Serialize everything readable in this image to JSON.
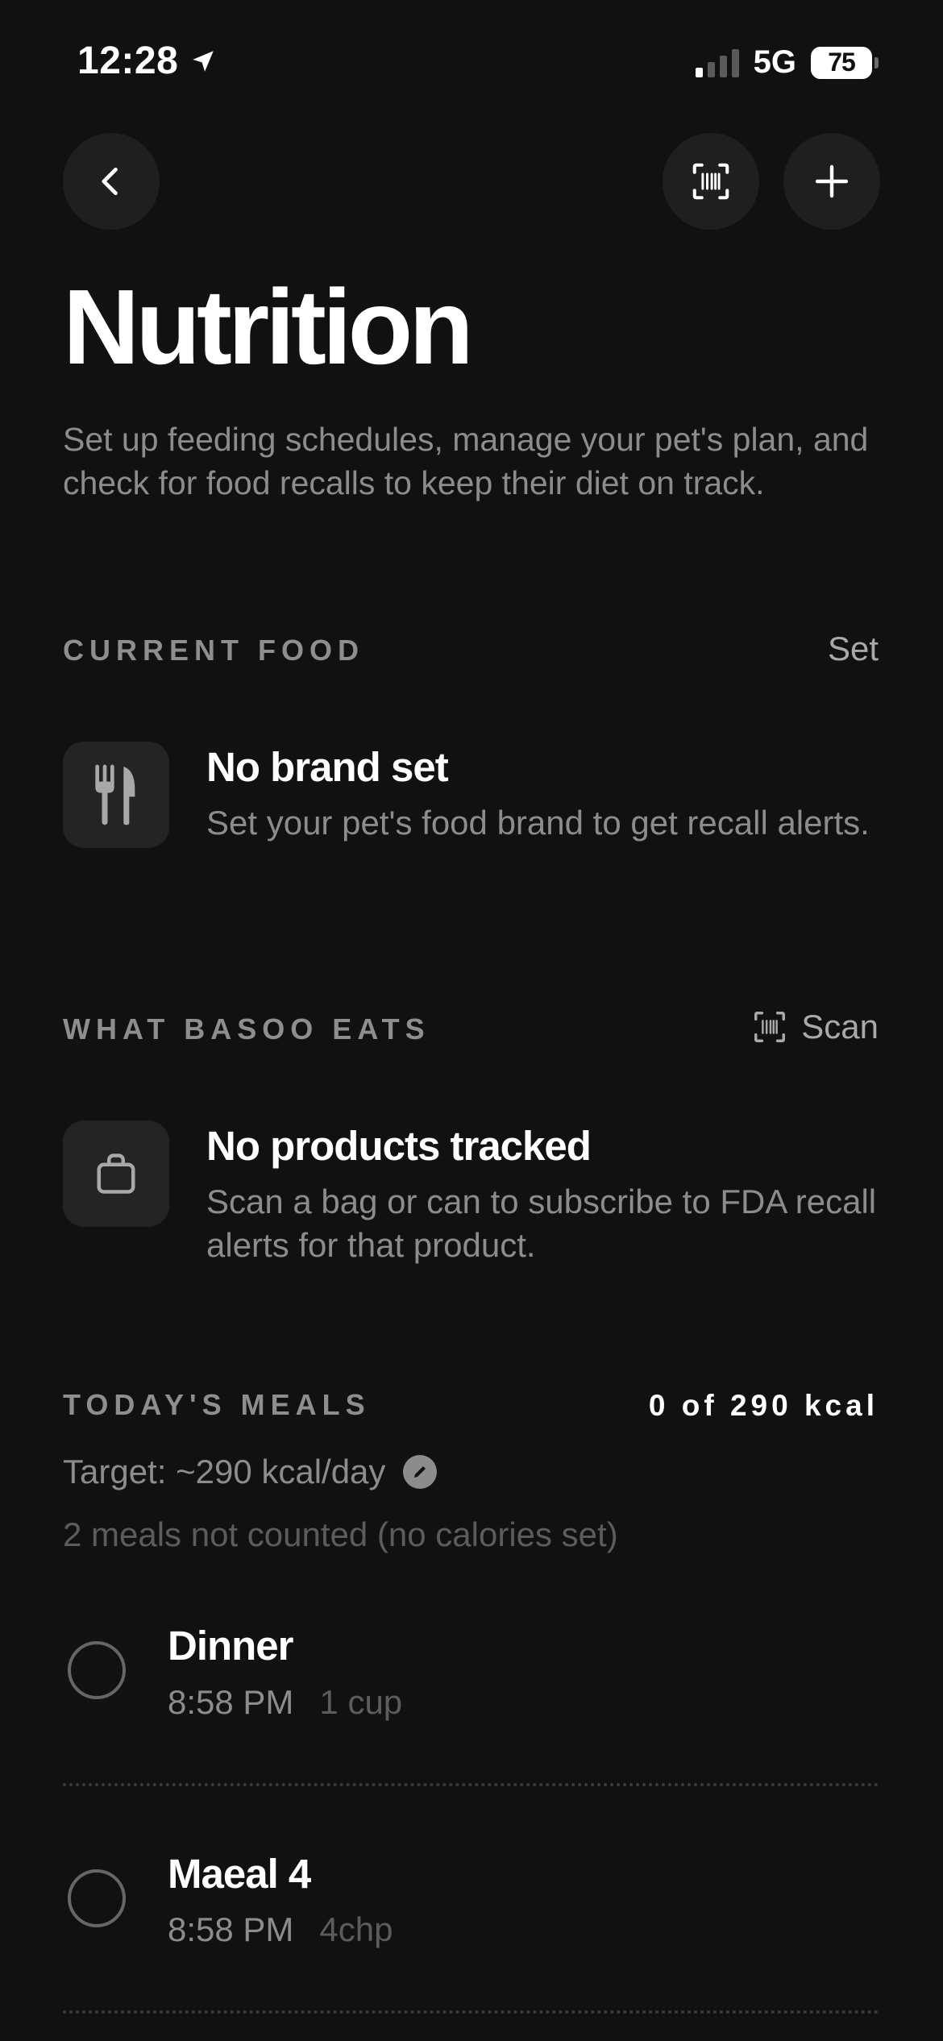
{
  "status_bar": {
    "time": "12:28",
    "location_icon": "location-arrow-icon",
    "network": "5G",
    "battery": "75"
  },
  "nav": {
    "back_icon": "chevron-left-icon",
    "scan_icon": "barcode-scan-icon",
    "add_icon": "plus-icon"
  },
  "header": {
    "title": "Nutrition",
    "description": "Set up feeding schedules, manage your pet's plan, and check for food recalls to keep their diet on track."
  },
  "current_food": {
    "heading": "CURRENT FOOD",
    "action": "Set",
    "icon": "fork-knife-icon",
    "title": "No brand set",
    "description": "Set your pet's food brand to get recall alerts."
  },
  "what_eats": {
    "heading": "WHAT BASOO EATS",
    "action": "Scan",
    "action_icon": "barcode-scan-icon",
    "icon": "bag-icon",
    "title": "No products tracked",
    "description": "Scan a bag or can to subscribe to FDA recall alerts for that product."
  },
  "meals": {
    "heading": "TODAY'S MEALS",
    "total": "0 of 290 kcal",
    "target": "Target: ~290 kcal/day",
    "edit_icon": "pencil-icon",
    "not_counted": "2 meals not counted (no calories set)",
    "items": [
      {
        "name": "Dinner",
        "time": "8:58 PM",
        "amount": "1 cup"
      },
      {
        "name": "Maeal 4",
        "time": "8:58 PM",
        "amount": "4chp"
      }
    ]
  },
  "colors": {
    "background": "#111111",
    "surface": "#1f1f1f",
    "tile": "#242424",
    "text_primary": "#ffffff",
    "text_secondary": "#8c8c8c",
    "text_tertiary": "#5c5c5c"
  }
}
